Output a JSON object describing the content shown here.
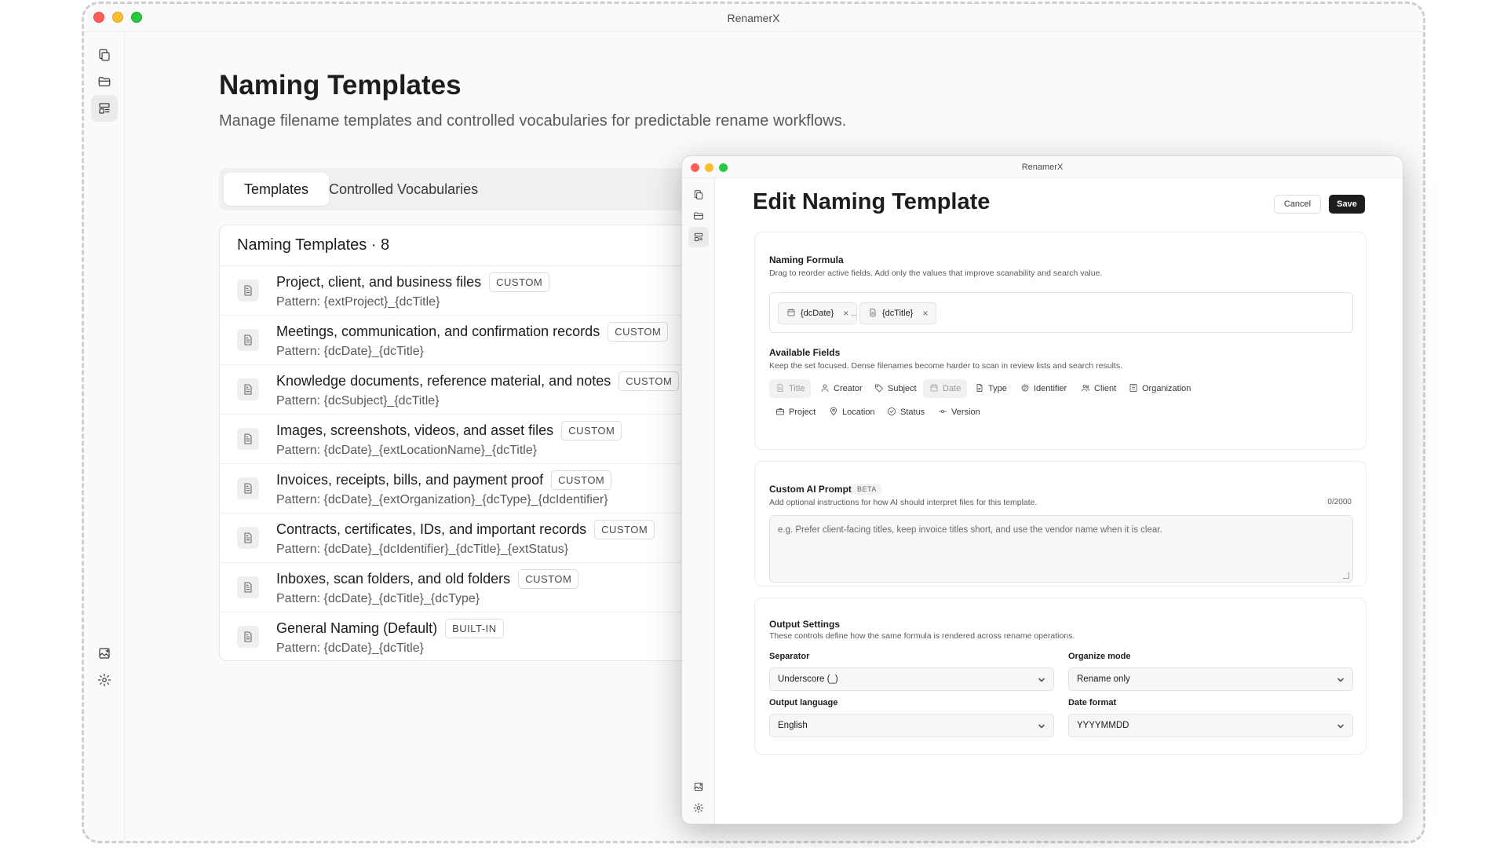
{
  "app": {
    "title": "RenamerX"
  },
  "sidebar": {
    "top_icons": [
      "files-icon",
      "folder-icon",
      "templates-icon"
    ],
    "bottom_icons": [
      "image-add-icon",
      "gear-icon"
    ]
  },
  "page": {
    "title": "Naming Templates",
    "subtitle": "Manage filename templates and controlled vocabularies for predictable rename workflows.",
    "tabs": [
      "Templates",
      "Controlled Vocabularies"
    ],
    "active_tab": "Templates"
  },
  "templates_list": {
    "header": "Naming Templates · 8",
    "items": [
      {
        "title": "Project, client, and business files",
        "badge": "CUSTOM",
        "pattern": "Pattern: {extProject}_{dcTitle}"
      },
      {
        "title": "Meetings, communication, and confirmation records",
        "badge": "CUSTOM",
        "pattern": "Pattern: {dcDate}_{dcTitle}"
      },
      {
        "title": "Knowledge documents, reference material, and notes",
        "badge": "CUSTOM",
        "pattern": "Pattern: {dcSubject}_{dcTitle}"
      },
      {
        "title": "Images, screenshots, videos, and asset files",
        "badge": "CUSTOM",
        "pattern": "Pattern: {dcDate}_{extLocationName}_{dcTitle}"
      },
      {
        "title": "Invoices, receipts, bills, and payment proof",
        "badge": "CUSTOM",
        "pattern": "Pattern: {dcDate}_{extOrganization}_{dcType}_{dcIdentifier}"
      },
      {
        "title": "Contracts, certificates, IDs, and important records",
        "badge": "CUSTOM",
        "pattern": "Pattern: {dcDate}_{dcIdentifier}_{dcTitle}_{extStatus}"
      },
      {
        "title": "Inboxes, scan folders, and old folders",
        "badge": "CUSTOM",
        "pattern": "Pattern: {dcDate}_{dcTitle}_{dcType}"
      },
      {
        "title": "General Naming (Default)",
        "badge": "BUILT-IN",
        "pattern": "Pattern: {dcDate}_{dcTitle}"
      }
    ]
  },
  "dialog": {
    "window_title": "RenamerX",
    "heading": "Edit Naming Template",
    "cancel_label": "Cancel",
    "save_label": "Save",
    "formula": {
      "title": "Naming Formula",
      "description": "Drag to reorder active fields. Add only the values that improve scanability and search value.",
      "chips": [
        {
          "label": "{dcDate}",
          "icon": "calendar-icon"
        },
        {
          "label": "{dcTitle}",
          "icon": "document-icon"
        }
      ],
      "separator": "_",
      "remove_symbol": "×",
      "available_title": "Available Fields",
      "available_description": "Keep the set focused. Dense filenames become harder to scan in review lists and search results.",
      "fields": [
        {
          "label": "Title",
          "icon": "document-icon",
          "used": true
        },
        {
          "label": "Creator",
          "icon": "person-icon",
          "used": false
        },
        {
          "label": "Subject",
          "icon": "tag-icon",
          "used": false
        },
        {
          "label": "Date",
          "icon": "calendar-icon",
          "used": true
        },
        {
          "label": "Type",
          "icon": "file-type-icon",
          "used": false
        },
        {
          "label": "Identifier",
          "icon": "fingerprint-icon",
          "used": false
        },
        {
          "label": "Client",
          "icon": "people-icon",
          "used": false
        },
        {
          "label": "Organization",
          "icon": "building-icon",
          "used": false
        },
        {
          "label": "Project",
          "icon": "briefcase-icon",
          "used": false
        },
        {
          "label": "Location",
          "icon": "pin-icon",
          "used": false
        },
        {
          "label": "Status",
          "icon": "check-circle-icon",
          "used": false
        },
        {
          "label": "Version",
          "icon": "commit-icon",
          "used": false
        }
      ]
    },
    "ai_prompt": {
      "title": "Custom AI Prompt",
      "badge": "BETA",
      "description": "Add optional instructions for how AI should interpret files for this template.",
      "counter": "0/2000",
      "placeholder": "e.g. Prefer client-facing titles, keep invoice titles short, and use the vendor name when it is clear."
    },
    "output": {
      "title": "Output Settings",
      "description": "These controls define how the same formula is rendered across rename operations.",
      "separator_label": "Separator",
      "separator_value": "Underscore (_)",
      "organize_label": "Organize mode",
      "organize_value": "Rename only",
      "language_label": "Output language",
      "language_value": "English",
      "date_label": "Date format",
      "date_value": "YYYYMMDD"
    }
  }
}
